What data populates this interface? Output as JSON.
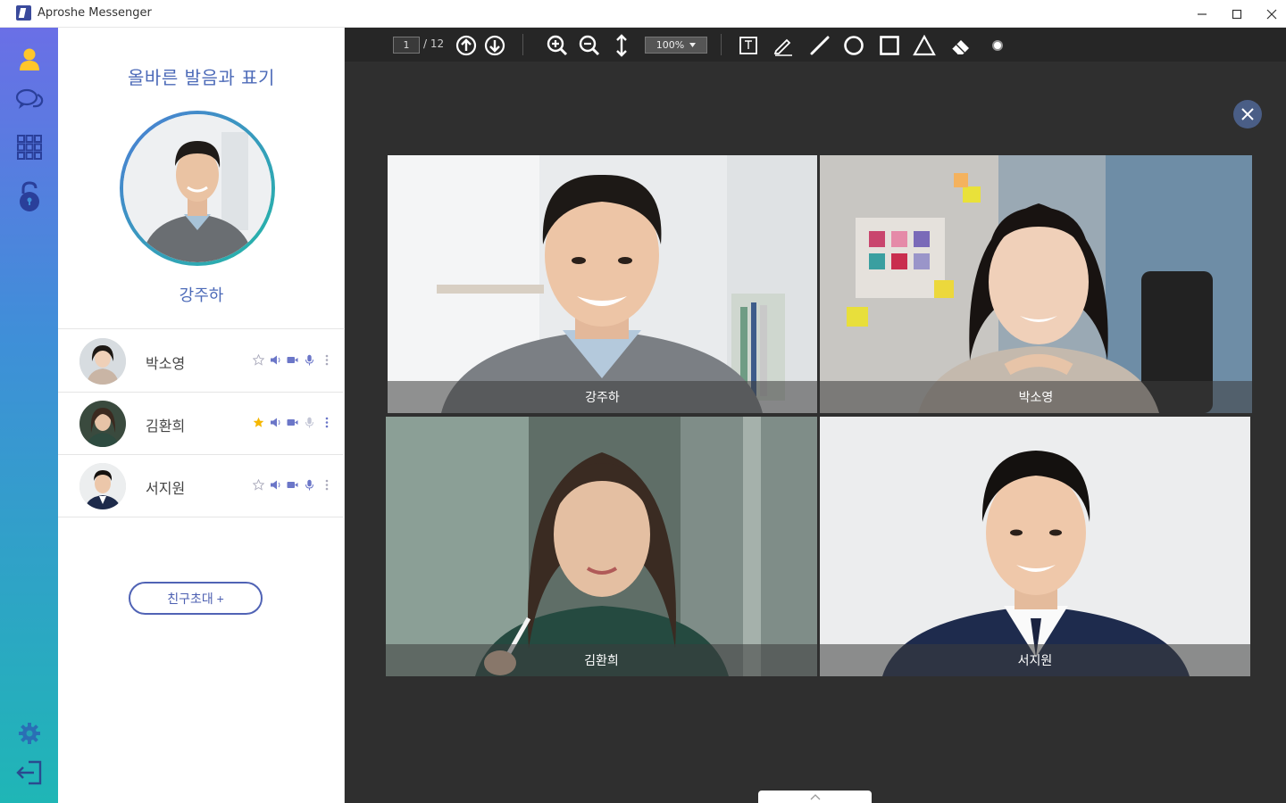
{
  "window": {
    "title": "Aproshe Messenger",
    "minimize_label": "—",
    "maximize_label": "☐",
    "close_label": "✕"
  },
  "colors": {
    "accent": "#4c6ab8",
    "rail_top": "#6a6fe6",
    "rail_bottom": "#1fb6b6",
    "star_active": "#f5b700",
    "main_bg": "#2f2f2f"
  },
  "rail": {
    "items": [
      "user-icon",
      "chat-icon",
      "grid-apps-icon",
      "unlock-icon"
    ],
    "bottom": [
      "settings-gear-icon",
      "logout-icon"
    ]
  },
  "panel": {
    "title": "올바른 발음과 표기",
    "host_name": "강주하",
    "members": [
      {
        "name": "박소영",
        "favorite": false
      },
      {
        "name": "김환희",
        "favorite": true
      },
      {
        "name": "서지원",
        "favorite": false
      }
    ],
    "invite_label": "친구초대 +"
  },
  "toolbar": {
    "page_current": "1",
    "page_total": "/ 12",
    "zoom": "100%"
  },
  "video_grid": {
    "tiles": [
      {
        "caption": "강주하"
      },
      {
        "caption": "박소영"
      },
      {
        "caption": "김환희"
      },
      {
        "caption": "서지원"
      }
    ]
  }
}
